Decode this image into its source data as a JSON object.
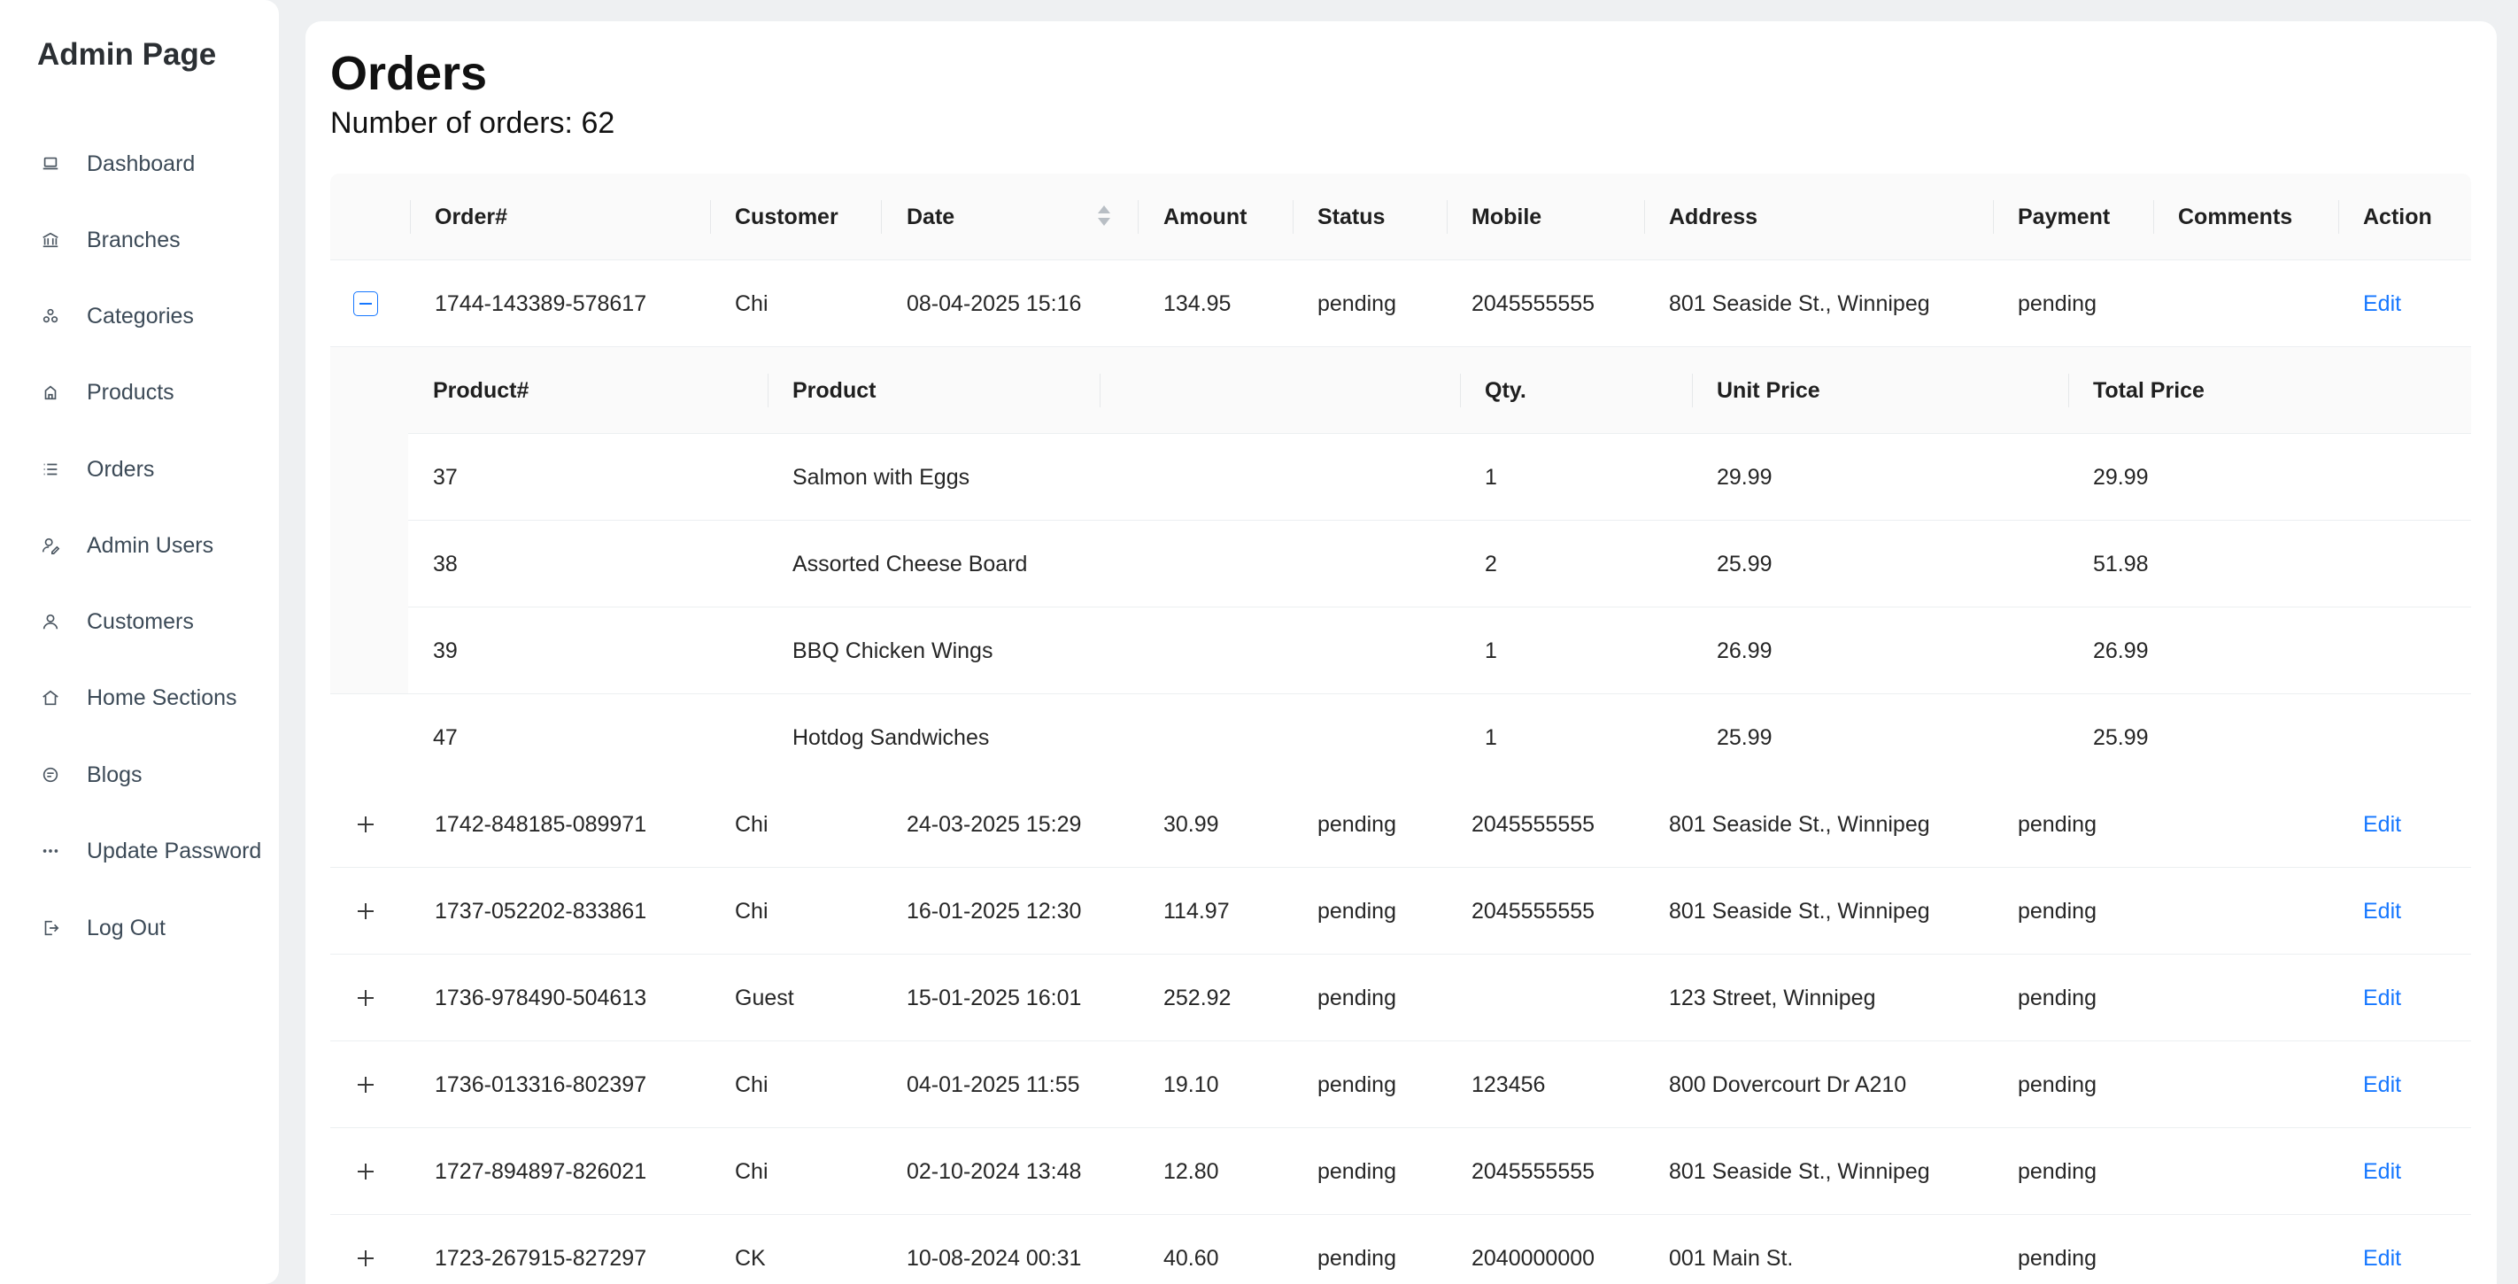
{
  "sidebar": {
    "brand": "Admin Page",
    "items": [
      {
        "label": "Dashboard",
        "icon": "laptop-icon"
      },
      {
        "label": "Branches",
        "icon": "bank-icon"
      },
      {
        "label": "Categories",
        "icon": "categories-icon"
      },
      {
        "label": "Products",
        "icon": "product-icon"
      },
      {
        "label": "Orders",
        "icon": "list-icon"
      },
      {
        "label": "Admin Users",
        "icon": "user-edit-icon"
      },
      {
        "label": "Customers",
        "icon": "user-icon"
      },
      {
        "label": "Home Sections",
        "icon": "home-icon"
      },
      {
        "label": "Blogs",
        "icon": "blog-icon"
      },
      {
        "label": "Update Password",
        "icon": "ellipsis-icon"
      },
      {
        "label": "Log Out",
        "icon": "logout-icon"
      }
    ]
  },
  "main": {
    "title": "Orders",
    "count_text": "Number of orders: 62"
  },
  "table": {
    "columns": [
      "Order#",
      "Customer",
      "Date",
      "Amount",
      "Status",
      "Mobile",
      "Address",
      "Payment",
      "Comments",
      "Action"
    ],
    "action_label": "Edit",
    "rows": [
      {
        "order": "1744-143389-578617",
        "customer": "Chi",
        "date": "08-04-2025 15:16",
        "amount": "134.95",
        "status": "pending",
        "mobile": "2045555555",
        "address": "801 Seaside St., Winnipeg",
        "payment": "pending",
        "comments": "",
        "expanded": true
      },
      {
        "order": "1742-848185-089971",
        "customer": "Chi",
        "date": "24-03-2025 15:29",
        "amount": "30.99",
        "status": "pending",
        "mobile": "2045555555",
        "address": "801 Seaside St., Winnipeg",
        "payment": "pending",
        "comments": ""
      },
      {
        "order": "1737-052202-833861",
        "customer": "Chi",
        "date": "16-01-2025 12:30",
        "amount": "114.97",
        "status": "pending",
        "mobile": "2045555555",
        "address": "801 Seaside St., Winnipeg",
        "payment": "pending",
        "comments": ""
      },
      {
        "order": "1736-978490-504613",
        "customer": "Guest",
        "date": "15-01-2025 16:01",
        "amount": "252.92",
        "status": "pending",
        "mobile": "",
        "address": "123 Street, Winnipeg",
        "payment": "pending",
        "comments": ""
      },
      {
        "order": "1736-013316-802397",
        "customer": "Chi",
        "date": "04-01-2025 11:55",
        "amount": "19.10",
        "status": "pending",
        "mobile": "123456",
        "address": "800 Dovercourt Dr A210",
        "payment": "pending",
        "comments": ""
      },
      {
        "order": "1727-894897-826021",
        "customer": "Chi",
        "date": "02-10-2024 13:48",
        "amount": "12.80",
        "status": "pending",
        "mobile": "2045555555",
        "address": "801 Seaside St., Winnipeg",
        "payment": "pending",
        "comments": ""
      },
      {
        "order": "1723-267915-827297",
        "customer": "CK",
        "date": "10-08-2024 00:31",
        "amount": "40.60",
        "status": "pending",
        "mobile": "2040000000",
        "address": "001 Main St.",
        "payment": "pending",
        "comments": ""
      }
    ]
  },
  "subtable": {
    "columns": [
      "Product#",
      "Product",
      "Qty.",
      "Unit Price",
      "Total Price"
    ],
    "rows": [
      {
        "id": "37",
        "product": "Salmon with Eggs",
        "qty": "1",
        "unit": "29.99",
        "total": "29.99"
      },
      {
        "id": "38",
        "product": "Assorted Cheese Board",
        "qty": "2",
        "unit": "25.99",
        "total": "51.98"
      },
      {
        "id": "39",
        "product": "BBQ Chicken Wings",
        "qty": "1",
        "unit": "26.99",
        "total": "26.99"
      },
      {
        "id": "47",
        "product": "Hotdog Sandwiches",
        "qty": "1",
        "unit": "25.99",
        "total": "25.99"
      }
    ]
  }
}
